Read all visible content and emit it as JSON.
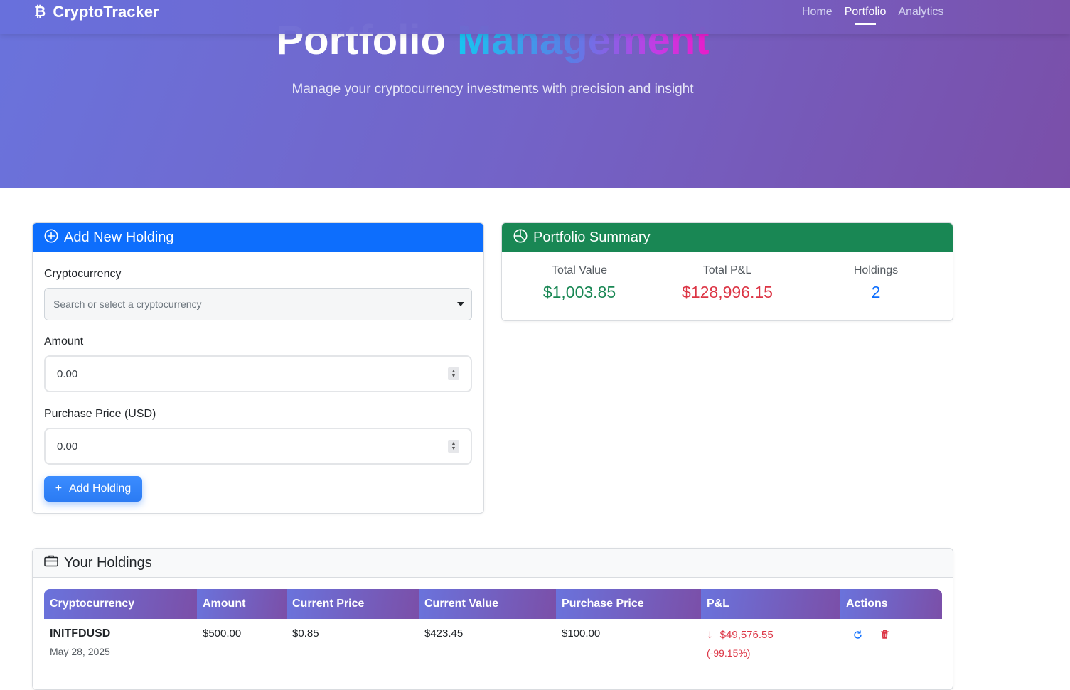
{
  "app": {
    "brand": "CryptoTracker",
    "brand_icon": "bitcoin-icon"
  },
  "nav": {
    "items": [
      {
        "label": "Home",
        "active": false
      },
      {
        "label": "Portfolio",
        "active": true
      },
      {
        "label": "Analytics",
        "active": false
      }
    ]
  },
  "hero": {
    "title_plain": "Portfolio",
    "title_gradient": "Management",
    "subtitle": "Manage your cryptocurrency investments with precision and insight"
  },
  "add_form": {
    "title": "Add New Holding",
    "crypto_label": "Cryptocurrency",
    "crypto_placeholder": "Search or select a cryptocurrency",
    "amount_label": "Amount",
    "amount_value": "0.00",
    "price_label": "Purchase Price (USD)",
    "price_value": "0.00",
    "submit_label": "Add Holding",
    "submit_icon": "+"
  },
  "summary": {
    "title": "Portfolio Summary",
    "total_value_label": "Total Value",
    "total_value": "$1,003.85",
    "total_pnl_label": "Total P&L",
    "total_pnl": "$128,996.15",
    "holdings_label": "Holdings",
    "holdings_count": "2"
  },
  "holdings": {
    "title": "Your Holdings",
    "columns": [
      "Cryptocurrency",
      "Amount",
      "Current Price",
      "Current Value",
      "Purchase Price",
      "P&L",
      "Actions"
    ],
    "rows": [
      {
        "symbol": "INITFDUSD",
        "date": "May 28, 2025",
        "amount": "$500.00",
        "current_price": "$0.85",
        "current_value": "$423.45",
        "purchase_price": "$100.00",
        "pnl_arrow": "↓",
        "pnl": "$49,576.55",
        "pnl_pct": "(-99.15%)"
      }
    ]
  },
  "colors": {
    "primary": "#0d6efd",
    "success": "#198754",
    "danger": "#dc3545",
    "hero_start": "#6a73dc",
    "hero_end": "#7a4fa9"
  }
}
